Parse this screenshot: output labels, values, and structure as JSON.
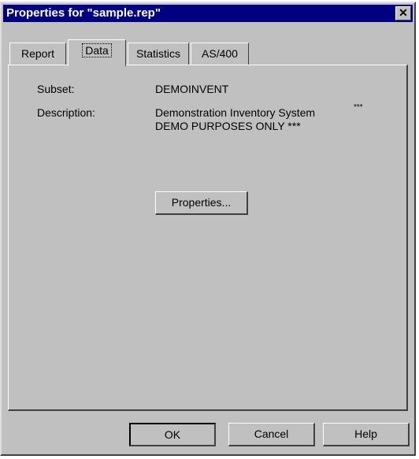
{
  "window": {
    "title": "Properties for \"sample.rep\"",
    "close_glyph": "✕"
  },
  "tabs": [
    {
      "label": "Report"
    },
    {
      "label": "Data"
    },
    {
      "label": "Statistics"
    },
    {
      "label": "AS/400"
    }
  ],
  "active_tab": "Data",
  "fields": {
    "subset_label": "Subset:",
    "subset_value": "DEMOINVENT",
    "description_label": "Description:",
    "description_line1": "Demonstration Inventory System",
    "description_asterisks": "***",
    "description_line2": "DEMO PURPOSES ONLY ***"
  },
  "properties_button": "Properties...",
  "footer": {
    "ok": "OK",
    "cancel": "Cancel",
    "help": "Help"
  }
}
